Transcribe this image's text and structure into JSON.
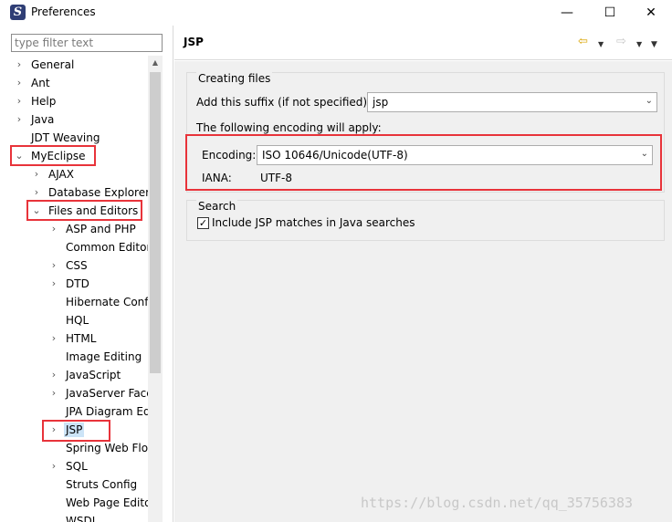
{
  "window": {
    "title": "Preferences",
    "minimize": "—",
    "maximize": "☐",
    "close": "✕",
    "app_icon_glyph": "S"
  },
  "sidebar": {
    "filter_placeholder": "type filter text",
    "items": [
      {
        "label": "General",
        "chevron": "›",
        "level": 0
      },
      {
        "label": "Ant",
        "chevron": "›",
        "level": 0
      },
      {
        "label": "Help",
        "chevron": "›",
        "level": 0
      },
      {
        "label": "Java",
        "chevron": "›",
        "level": 0
      },
      {
        "label": "JDT Weaving",
        "chevron": "",
        "level": 0
      },
      {
        "label": "MyEclipse",
        "chevron": "⌄",
        "level": 0
      },
      {
        "label": "AJAX",
        "chevron": "›",
        "level": 1
      },
      {
        "label": "Database Explorer",
        "chevron": "›",
        "level": 1
      },
      {
        "label": "Files and Editors",
        "chevron": "⌄",
        "level": 1
      },
      {
        "label": "ASP and PHP",
        "chevron": "›",
        "level": 2
      },
      {
        "label": "Common Editors",
        "chevron": "",
        "level": 2
      },
      {
        "label": "CSS",
        "chevron": "›",
        "level": 2
      },
      {
        "label": "DTD",
        "chevron": "›",
        "level": 2
      },
      {
        "label": "Hibernate Config",
        "chevron": "",
        "level": 2
      },
      {
        "label": "HQL",
        "chevron": "",
        "level": 2
      },
      {
        "label": "HTML",
        "chevron": "›",
        "level": 2
      },
      {
        "label": "Image Editing",
        "chevron": "",
        "level": 2
      },
      {
        "label": "JavaScript",
        "chevron": "›",
        "level": 2
      },
      {
        "label": "JavaServer Faces",
        "chevron": "›",
        "level": 2
      },
      {
        "label": "JPA Diagram Editor",
        "chevron": "",
        "level": 2
      },
      {
        "label": "JSP",
        "chevron": "›",
        "level": 2,
        "selected": true
      },
      {
        "label": "Spring Web Flow",
        "chevron": "",
        "level": 2
      },
      {
        "label": "SQL",
        "chevron": "›",
        "level": 2
      },
      {
        "label": "Struts Config",
        "chevron": "",
        "level": 2
      },
      {
        "label": "Web Page Editor",
        "chevron": "",
        "level": 2
      },
      {
        "label": "WSDL",
        "chevron": "",
        "level": 2
      }
    ]
  },
  "page": {
    "title": "JSP",
    "nav_back_icon": "⇦",
    "nav_forward_icon": "⇨",
    "dropdown_glyph": "▼",
    "creating_files": {
      "group_label": "Creating files",
      "suffix_label": "Add this suffix (if not specified):",
      "suffix_value": "jsp",
      "encoding_note": "The following encoding will apply:",
      "encoding_label": "Encoding:",
      "encoding_value": "ISO 10646/Unicode(UTF-8)",
      "iana_label": "IANA:",
      "iana_value": "UTF-8"
    },
    "search": {
      "group_label": "Search",
      "include_label": "Include JSP matches in Java searches",
      "include_checked": true,
      "check_glyph": "✓"
    },
    "combo_arrow": "⌄"
  },
  "watermark": "https://blog.csdn.net/qq_35756383",
  "colors": {
    "annotation_red": "#e8333a",
    "selection_blue": "#cce4f7",
    "back_arrow": "#d9a400"
  }
}
